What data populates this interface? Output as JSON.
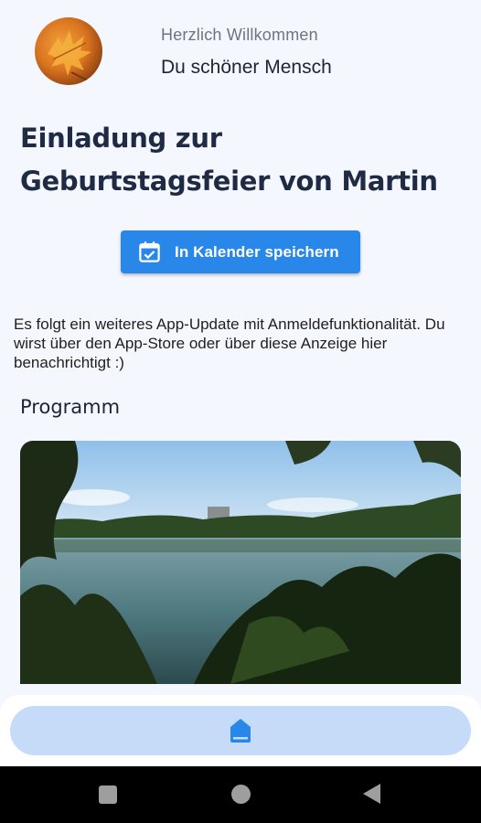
{
  "header": {
    "greeting": "Herzlich Willkommen",
    "username": "Du schöner Mensch",
    "avatar_icon": "autumn-leaf-avatar"
  },
  "invitation": {
    "title_line1": "Einladung zur",
    "title_line2": "Geburtstagsfeier von Martin"
  },
  "calendar_button": {
    "label": "In Kalender speichern",
    "icon": "calendar-check-icon"
  },
  "notice": {
    "text": "Es folgt ein weiteres App-Update mit Anmeldefunktionalität. Du wirst über den App-Store oder über diese Anzeige hier benachrichtigt :)"
  },
  "program": {
    "heading": "Programm",
    "image": "lake-photo"
  },
  "bottom_nav": {
    "active_item": "home-icon"
  },
  "system_nav": {
    "buttons": [
      "recents-icon",
      "home-circle-icon",
      "back-icon"
    ]
  },
  "colors": {
    "primary": "#2a87ea",
    "background": "#f4f7fd",
    "nav_pill": "#c5dbf8",
    "title": "#1f2a44"
  }
}
